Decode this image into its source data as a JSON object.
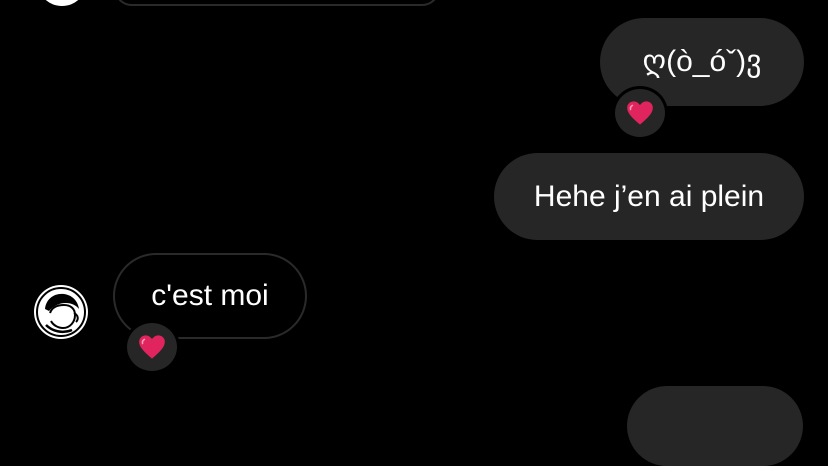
{
  "messages": [
    {
      "id": "m1",
      "direction": "outgoing",
      "text": "ღ(ò_óˇ)ვ",
      "reaction": "❤️"
    },
    {
      "id": "m2",
      "direction": "outgoing",
      "text": "Hehe j’en ai plein"
    },
    {
      "id": "m3",
      "direction": "incoming",
      "text": "c'est moi",
      "reaction": "❤️"
    }
  ],
  "colors": {
    "background": "#000000",
    "outgoing_bubble": "#262626",
    "incoming_border": "#2a2a2a",
    "text": "#ffffff",
    "heart": "#e0245e"
  },
  "icons": {
    "reaction": "heart-icon",
    "avatar": "profile-avatar-icon"
  }
}
